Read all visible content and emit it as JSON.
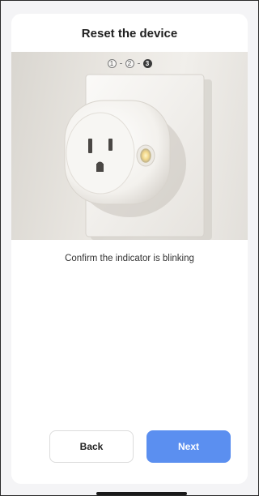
{
  "header": {
    "title": "Reset the device"
  },
  "steps": {
    "items": [
      "1",
      "2",
      "3"
    ],
    "current": 3
  },
  "photo": {
    "subject": "smart-plug-in-wall-outlet",
    "indicator": "blinking"
  },
  "instruction": "Confirm the indicator is blinking",
  "buttons": {
    "back_label": "Back",
    "next_label": "Next"
  },
  "colors": {
    "primary": "#5b8ff0",
    "background": "#f4f4f6",
    "card": "#ffffff"
  }
}
